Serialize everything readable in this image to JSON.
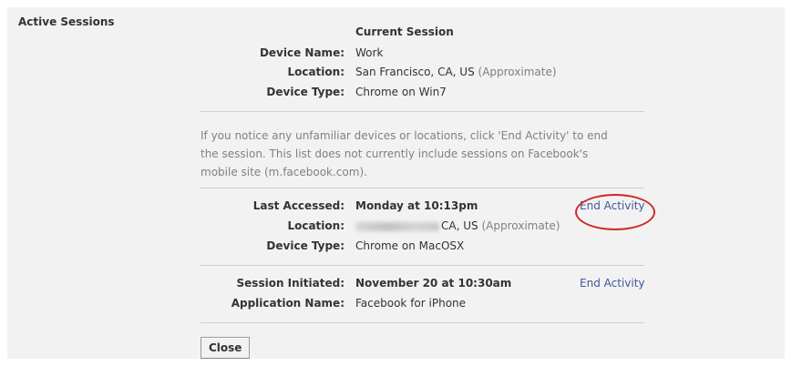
{
  "title": "Active Sessions",
  "current": {
    "heading": "Current Session",
    "device_name_label": "Device Name:",
    "device_name": "Work",
    "location_label": "Location:",
    "location": "San Francisco, CA, US",
    "location_note": "(Approximate)",
    "device_type_label": "Device Type:",
    "device_type": "Chrome on Win7"
  },
  "notice": "If you notice any unfamiliar devices or locations, click 'End Activity' to end the session. This list does not currently include sessions on Facebook's mobile site (m.facebook.com).",
  "sessions": [
    {
      "last_accessed_label": "Last Accessed:",
      "last_accessed": "Monday at 10:13pm",
      "location_label": "Location:",
      "location": "CA, US",
      "location_note": "(Approximate)",
      "device_type_label": "Device Type:",
      "device_type": "Chrome on MacOSX",
      "end_label": "End Activity"
    },
    {
      "initiated_label": "Session Initiated:",
      "initiated": "November 20 at 10:30am",
      "app_label": "Application Name:",
      "app": "Facebook for iPhone",
      "end_label": "End Activity"
    }
  ],
  "close_label": "Close",
  "colors": {
    "link": "#3b5998",
    "highlight_circle": "#cc2a2a",
    "panel_bg": "#f2f2f2"
  }
}
